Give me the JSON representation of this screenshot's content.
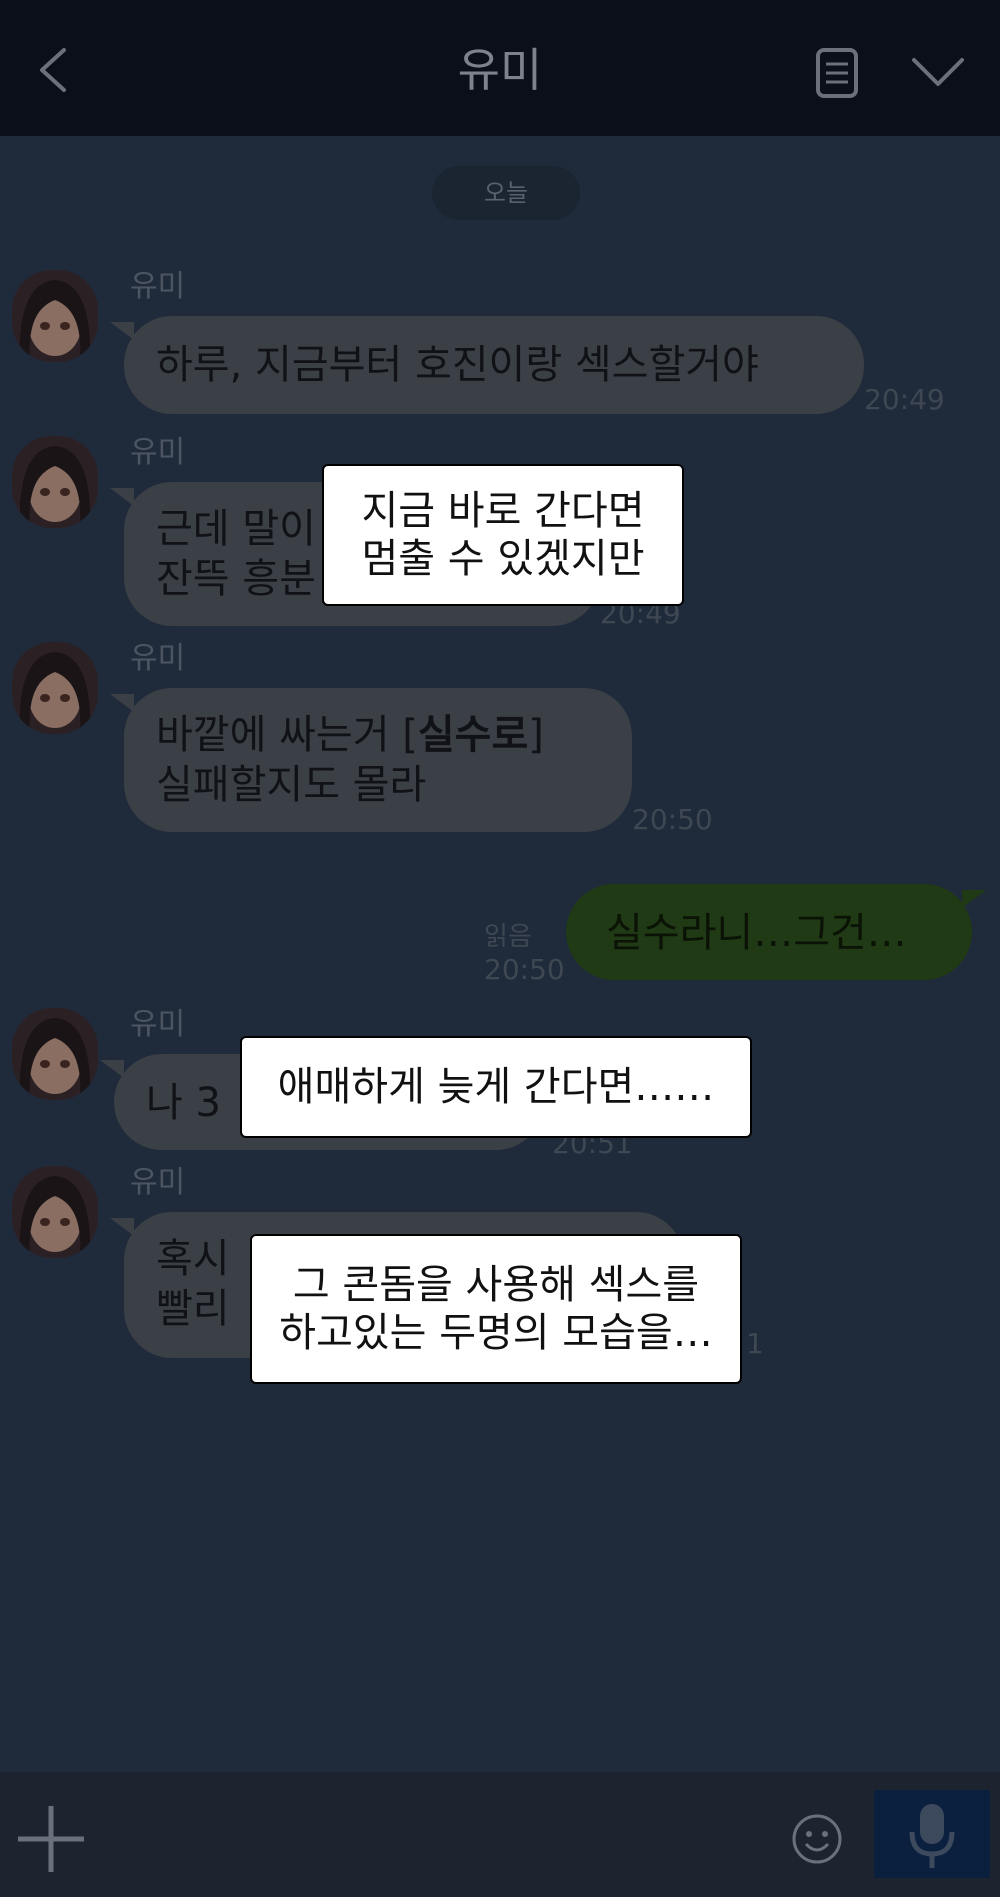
{
  "header": {
    "title": "유미"
  },
  "chat": {
    "date_label": "오늘",
    "messages": [
      {
        "sender": "유미",
        "text": "하루, 지금부터 호진이랑 섹스할거야",
        "time": "20:49"
      },
      {
        "sender": "유미",
        "line1": "근데 말이",
        "line2": "잔뜩 흥분",
        "time": "20:49"
      },
      {
        "sender": "유미",
        "line1_pre": "바깥에 싸는거 [",
        "line1_bold": "실수로",
        "line1_post": "]",
        "line2": "실패할지도 몰라",
        "time": "20:50"
      },
      {
        "mine": true,
        "text": "실수라니…그건…",
        "read": "읽음",
        "time": "20:50"
      },
      {
        "sender": "유미",
        "text": "나 3",
        "time": "20:51"
      },
      {
        "sender": "유미",
        "line1": "혹시",
        "line2": "빨리",
        "time": "1"
      }
    ]
  },
  "captions": [
    {
      "line1": "지금 바로 간다면",
      "line2": "멈출 수 있겠지만"
    },
    {
      "line1": "애매하게 늦게 간다면……"
    },
    {
      "line1": "그 콘돔을 사용해 섹스를",
      "line2": "하고있는 두명의 모습을…"
    }
  ],
  "colors": {
    "background": "#1f2a3a",
    "header": "#0a0f1a",
    "incoming_bubble": "#3b3f46",
    "outgoing_bubble": "#1f3a14",
    "mic_button": "#0b1f3f"
  },
  "icons": [
    "back-icon",
    "menu-icon",
    "chevron-down-icon",
    "plus-icon",
    "emoji-icon",
    "microphone-icon"
  ]
}
